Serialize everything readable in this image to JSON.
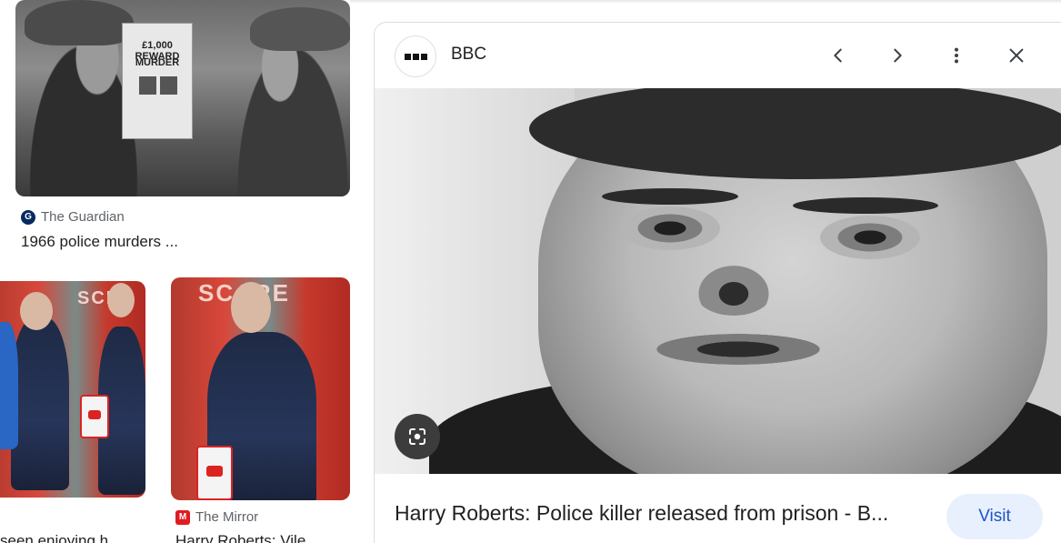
{
  "results": [
    {
      "source": "The Guardian",
      "source_icon": "guardian-logo-icon",
      "source_color": "#052962",
      "caption": "1966 police murders ...",
      "poster_line1": "£1,000 REWARD",
      "poster_line2": "MURDER"
    },
    {
      "source": "",
      "caption": "seen enjoying h...",
      "bus_sign": "SCRE"
    },
    {
      "source": "The Mirror",
      "source_icon": "mirror-logo-icon",
      "source_color": "#e01b22",
      "caption": "Harry Roberts: Vile ...",
      "bus_sign": "SCARE"
    }
  ],
  "preview": {
    "site_name": "BBC",
    "site_icon": "bbc-logo-icon",
    "title": "Harry Roberts: Police killer released from prison - B...",
    "visit_label": "Visit",
    "accent": "#1a56c4",
    "visit_bg": "#e8f0fe"
  }
}
